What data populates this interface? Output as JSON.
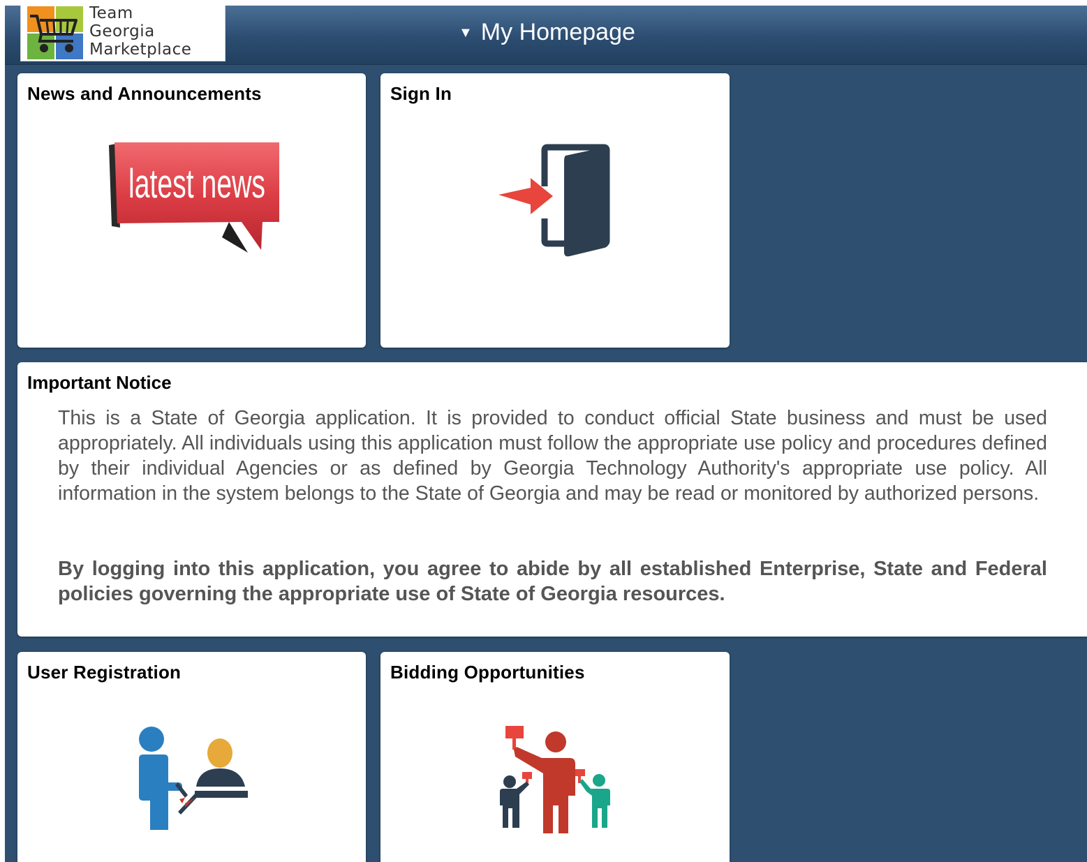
{
  "header": {
    "logo": {
      "line1": "Team",
      "line2": "Georgia",
      "line3": "Marketplace"
    },
    "homepage_caret": "▼",
    "homepage_title": "My Homepage"
  },
  "tiles": {
    "news": {
      "title": "News and Announcements",
      "graphic_text": "latest news"
    },
    "signin": {
      "title": "Sign In"
    },
    "registration": {
      "title": "User Registration"
    },
    "bidding": {
      "title": "Bidding Opportunities"
    }
  },
  "notice": {
    "title": "Important Notice",
    "body": "This is a State of Georgia application. It is provided to conduct official State business and must be used appropriately. All individuals using this application must follow the appropriate use policy and procedures defined by their individual Agencies or as defined by Georgia Technology Authority's appropriate use policy. All information in the system belongs to the State of Georgia and may be read or monitored by authorized persons.",
    "agreement": "By logging into this application, you agree to abide by all established Enterprise, State and Federal policies governing the appropriate use of State of Georgia resources."
  },
  "icons": {
    "logo": "shopping-cart-logo",
    "news": "latest-news-speech-bubble",
    "signin": "door-enter-arrow",
    "registration": "user-registration-people",
    "bidding": "bidding-people-paddles"
  },
  "colors": {
    "background": "#2e4f6f",
    "header_top": "#4b6f95",
    "header_bottom": "#22405f",
    "tile": "#ffffff",
    "notice_text": "#555555",
    "news_red": "#d8343d",
    "arrow_red": "#e8453c",
    "door_navy": "#2c3e50",
    "person_blue": "#2a7fc1",
    "person_gold": "#e6a93a",
    "bidder_red": "#c0392b",
    "bidder_teal": "#1aa68a"
  }
}
